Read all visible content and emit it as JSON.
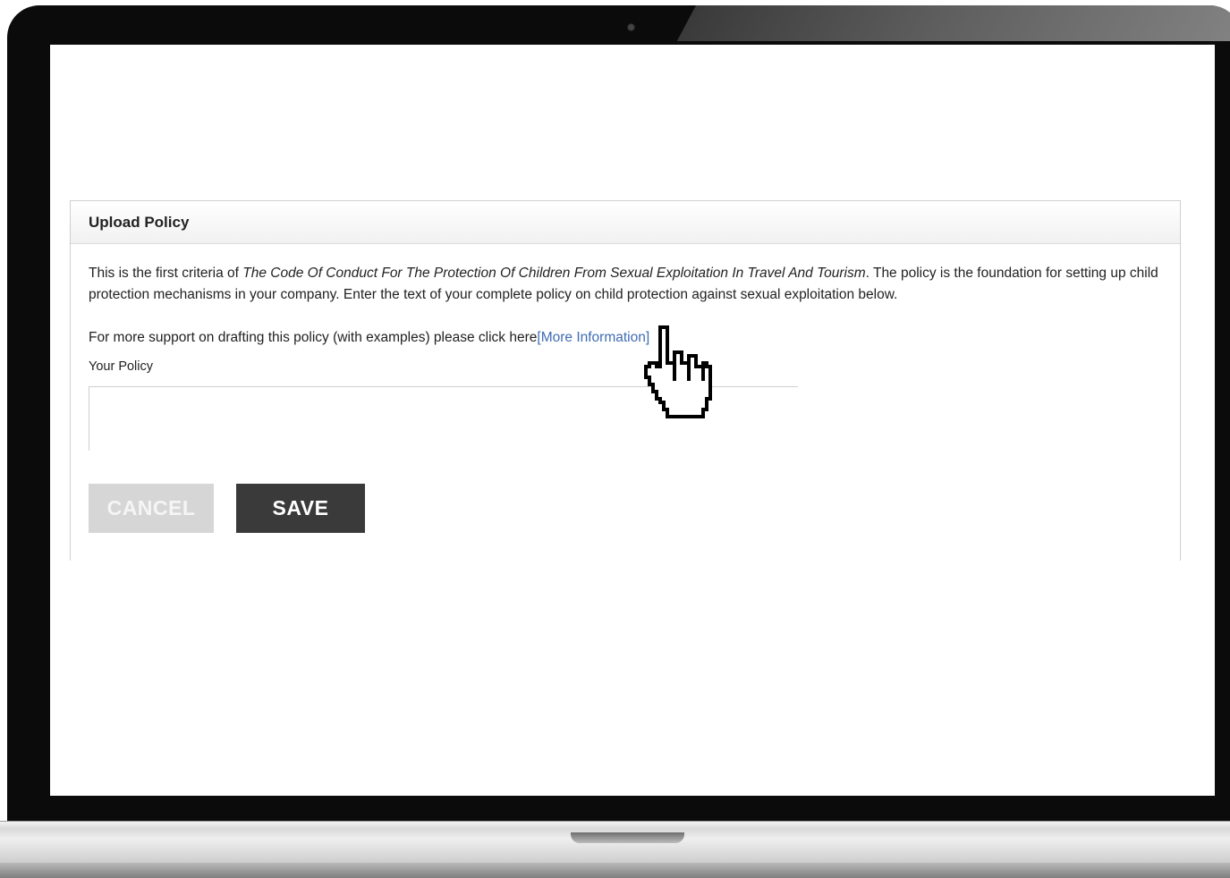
{
  "panel": {
    "title": "Upload Policy",
    "intro_before": "This is the first criteria of ",
    "intro_emphasis": "The Code Of Conduct For The Protection Of Children From Sexual Exploitation In Travel And Tourism",
    "intro_after": ". The policy is the foundation for setting up child protection mechanisms in your company. Enter the text of your complete policy on child protection against sexual exploitation below.",
    "support_text": "For more support on drafting this policy (with examples) please click here",
    "support_link": "[More Information]",
    "policy_label": "Your Policy",
    "policy_value": ""
  },
  "actions": {
    "cancel_label": "CANCEL",
    "save_label": "SAVE"
  },
  "cursor": {
    "icon": "hand-pointer-icon"
  },
  "colors": {
    "link": "#3f6cb3",
    "save_bg": "#3a3a3a",
    "cancel_bg": "#d6d6d6"
  }
}
